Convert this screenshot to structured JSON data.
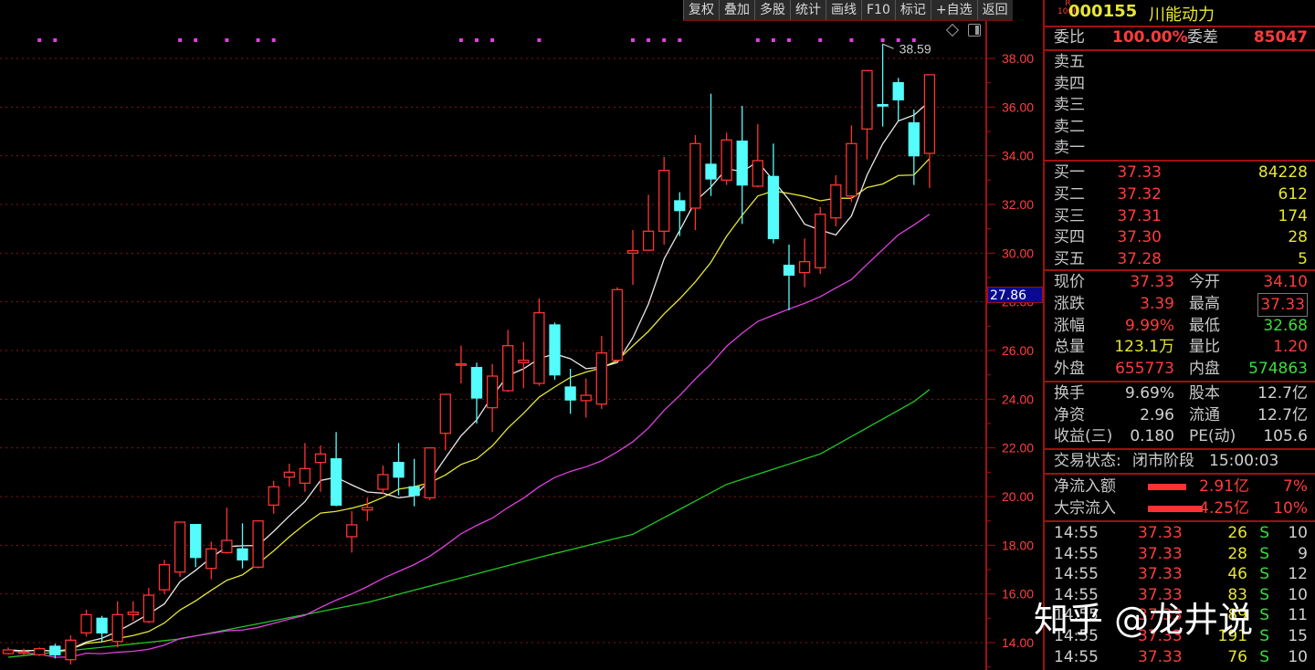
{
  "toolbar": [
    "复权",
    "叠加",
    "多股",
    "统计",
    "画线",
    "F10",
    "标记",
    "+自选",
    "返回"
  ],
  "stock": {
    "badge_top": "R",
    "badge_bottom": "1000",
    "code": "000155",
    "name": "川能动力"
  },
  "commission": {
    "ratio_label": "委比",
    "ratio": "100.00%",
    "diff_label": "委差",
    "diff": "85047"
  },
  "asks": [
    {
      "label": "卖五"
    },
    {
      "label": "卖四"
    },
    {
      "label": "卖三"
    },
    {
      "label": "卖二"
    },
    {
      "label": "卖一"
    }
  ],
  "bids": [
    {
      "label": "买一",
      "price": "37.33",
      "vol": "84228"
    },
    {
      "label": "买二",
      "price": "37.32",
      "vol": "612"
    },
    {
      "label": "买三",
      "price": "37.31",
      "vol": "174"
    },
    {
      "label": "买四",
      "price": "37.30",
      "vol": "28"
    },
    {
      "label": "买五",
      "price": "37.28",
      "vol": "5"
    }
  ],
  "quote": [
    {
      "l1": "现价",
      "v1": "37.33",
      "c1": "red",
      "l2": "今开",
      "v2": "34.10",
      "c2": "red"
    },
    {
      "l1": "涨跌",
      "v1": "3.39",
      "c1": "red",
      "l2": "最高",
      "v2": "37.33",
      "c2": "red"
    },
    {
      "l1": "涨幅",
      "v1": "9.99%",
      "c1": "red",
      "l2": "最低",
      "v2": "32.68",
      "c2": "grn"
    },
    {
      "l1": "总量",
      "v1": "123.1万",
      "c1": "yel",
      "l2": "量比",
      "v2": "1.20",
      "c2": "red"
    },
    {
      "l1": "外盘",
      "v1": "655773",
      "c1": "red",
      "l2": "内盘",
      "v2": "574863",
      "c2": "grn"
    }
  ],
  "fundamentals": [
    {
      "l1": "换手",
      "v1": "9.69%",
      "l2": "股本",
      "v2": "12.7亿"
    },
    {
      "l1": "净资",
      "v1": "2.96",
      "l2": "流通",
      "v2": "12.7亿"
    },
    {
      "l1": "收益(三)",
      "v1": "0.180",
      "l2": "PE(动)",
      "v2": "105.6"
    }
  ],
  "status": {
    "label": "交易状态:",
    "value": "闭市阶段",
    "time": "15:00:03"
  },
  "flows": [
    {
      "label": "净流入额",
      "amount": "2.91亿",
      "pct": "7%",
      "bar": 0.07
    },
    {
      "label": "大宗流入",
      "amount": "4.25亿",
      "pct": "10%",
      "bar": 0.1
    }
  ],
  "ticks": [
    {
      "time": "14:55",
      "price": "37.33",
      "vol": "26",
      "side": "S",
      "n": "10"
    },
    {
      "time": "14:55",
      "price": "37.33",
      "vol": "28",
      "side": "S",
      "n": "9"
    },
    {
      "time": "14:55",
      "price": "37.33",
      "vol": "46",
      "side": "S",
      "n": "12"
    },
    {
      "time": "14:55",
      "price": "37.33",
      "vol": "83",
      "side": "S",
      "n": "10"
    },
    {
      "time": "14:55",
      "price": "37.33",
      "vol": "89",
      "side": "S",
      "n": "11"
    },
    {
      "time": "14:55",
      "price": "37.33",
      "vol": "191",
      "side": "S",
      "n": "15"
    },
    {
      "time": "14:55",
      "price": "37.33",
      "vol": "76",
      "side": "S",
      "n": "10"
    }
  ],
  "watermark": "知乎 @龙井说",
  "cursor_price": "27.86",
  "colors": {
    "up": "#ff3232",
    "down": "#54fcfc",
    "ma5": "#e8e8e8",
    "ma10": "#e6e632",
    "ma20": "#e040e0",
    "ma60": "#22c822",
    "grid": "#8a1414",
    "marker": "#e040e0"
  },
  "chart_data": {
    "type": "candlestick",
    "ylim": [
      13.4,
      39.4
    ],
    "yticks": [
      "14.00",
      "16.00",
      "18.00",
      "20.00",
      "22.00",
      "24.00",
      "26.00",
      "28.00",
      "30.00",
      "32.00",
      "34.00",
      "36.00",
      "38.00"
    ],
    "high_label": "38.59",
    "high_index": 56,
    "marker_indices": [
      2,
      3,
      11,
      12,
      14,
      16,
      17,
      29,
      30,
      31,
      34,
      40,
      41,
      42,
      43,
      48,
      49,
      50,
      52,
      54,
      56,
      57,
      58
    ],
    "ohlc": [
      [
        13.55,
        13.8,
        13.5,
        13.7
      ],
      [
        13.6,
        13.75,
        13.5,
        13.62
      ],
      [
        13.5,
        13.8,
        13.45,
        13.75
      ],
      [
        13.85,
        13.95,
        13.35,
        13.5
      ],
      [
        13.3,
        14.3,
        13.1,
        14.1
      ],
      [
        14.4,
        15.35,
        14.25,
        15.15
      ],
      [
        15.0,
        15.1,
        14.0,
        14.4
      ],
      [
        14.05,
        15.7,
        13.8,
        15.15
      ],
      [
        15.15,
        15.7,
        14.9,
        15.25
      ],
      [
        14.86,
        16.25,
        14.8,
        15.95
      ],
      [
        16.17,
        17.4,
        16.0,
        17.2
      ],
      [
        16.9,
        18.95,
        16.7,
        18.95
      ],
      [
        18.85,
        18.85,
        17.1,
        17.5
      ],
      [
        17.05,
        18.15,
        16.6,
        17.85
      ],
      [
        17.7,
        19.55,
        17.65,
        18.2
      ],
      [
        17.85,
        18.9,
        17.05,
        17.4
      ],
      [
        17.1,
        19.0,
        17.05,
        19.0
      ],
      [
        19.65,
        20.65,
        19.3,
        20.4
      ],
      [
        20.8,
        21.35,
        20.4,
        21.0
      ],
      [
        20.55,
        22.2,
        20.2,
        21.15
      ],
      [
        21.4,
        22.1,
        20.2,
        21.75
      ],
      [
        21.55,
        22.65,
        19.6,
        19.65
      ],
      [
        18.35,
        19.4,
        17.7,
        18.84
      ],
      [
        19.45,
        19.95,
        19.0,
        19.55
      ],
      [
        20.3,
        21.27,
        20.1,
        20.9
      ],
      [
        21.4,
        22.2,
        20.05,
        20.8
      ],
      [
        20.4,
        21.55,
        19.6,
        20.05
      ],
      [
        19.95,
        22.0,
        19.85,
        22.0
      ],
      [
        22.6,
        24.2,
        21.9,
        24.2
      ],
      [
        25.4,
        26.2,
        24.65,
        25.45
      ],
      [
        25.3,
        25.5,
        23.0,
        24.05
      ],
      [
        23.65,
        25.45,
        22.65,
        24.95
      ],
      [
        24.35,
        26.85,
        24.3,
        26.2
      ],
      [
        25.5,
        26.35,
        24.45,
        25.6
      ],
      [
        24.65,
        28.15,
        24.55,
        27.55
      ],
      [
        27.05,
        27.15,
        24.8,
        25.0
      ],
      [
        24.5,
        25.25,
        23.4,
        23.97
      ],
      [
        23.94,
        24.85,
        23.25,
        24.16
      ],
      [
        23.8,
        26.6,
        23.6,
        25.9
      ],
      [
        25.6,
        28.6,
        25.55,
        28.5
      ],
      [
        30.0,
        30.95,
        28.7,
        30.1
      ],
      [
        30.12,
        32.4,
        30.1,
        30.9
      ],
      [
        30.9,
        33.95,
        30.35,
        33.4
      ],
      [
        32.15,
        32.5,
        30.7,
        31.75
      ],
      [
        31.85,
        34.85,
        30.95,
        34.5
      ],
      [
        33.65,
        36.55,
        32.35,
        33.05
      ],
      [
        33.0,
        34.95,
        32.8,
        34.65
      ],
      [
        34.6,
        36.05,
        31.2,
        32.8
      ],
      [
        32.75,
        35.3,
        32.7,
        33.8
      ],
      [
        33.15,
        34.5,
        30.4,
        30.6
      ],
      [
        29.5,
        30.35,
        27.65,
        29.1
      ],
      [
        29.2,
        30.6,
        28.6,
        29.65
      ],
      [
        29.4,
        31.9,
        29.15,
        31.6
      ],
      [
        31.45,
        33.2,
        31.1,
        32.8
      ],
      [
        32.35,
        35.25,
        32.1,
        34.5
      ],
      [
        35.1,
        37.5,
        33.85,
        37.5
      ],
      [
        36.1,
        38.59,
        35.2,
        36.05
      ],
      [
        37.0,
        37.2,
        35.45,
        36.3
      ],
      [
        35.35,
        35.9,
        32.8,
        34.0
      ],
      [
        34.1,
        37.33,
        32.68,
        37.33
      ]
    ],
    "ma60_anchors": [
      [
        0,
        13.4
      ],
      [
        11,
        14.15
      ],
      [
        23,
        15.65
      ],
      [
        34,
        17.5
      ],
      [
        40,
        18.45
      ],
      [
        46,
        20.5
      ],
      [
        52,
        21.75
      ],
      [
        58,
        23.9
      ],
      [
        59,
        24.4
      ]
    ]
  }
}
